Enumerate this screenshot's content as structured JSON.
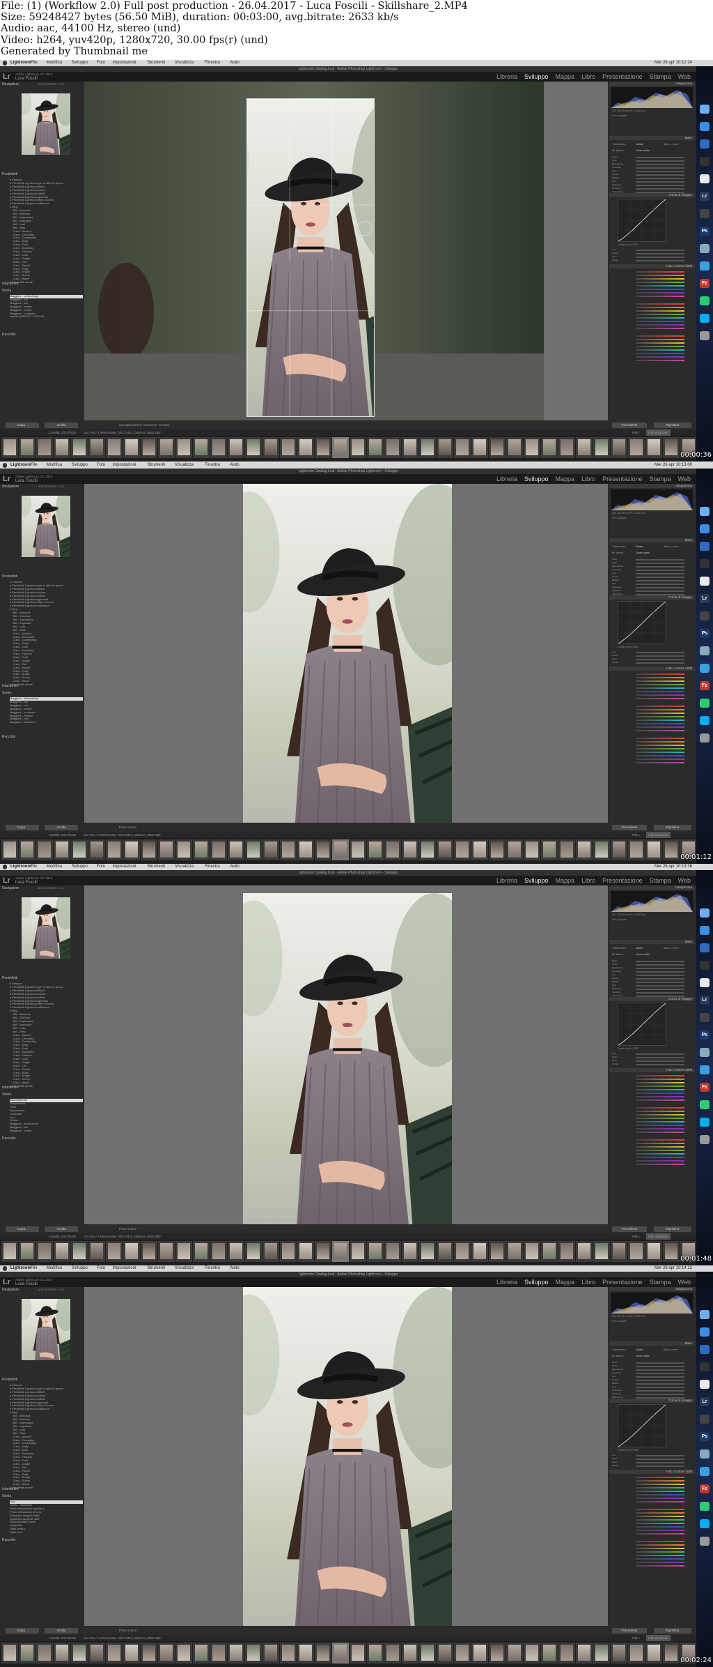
{
  "header": {
    "line1": "File: (1) (Workflow 2.0) Full post production - 26.04.2017 - Luca Foscili - Skillshare_2.MP4",
    "line2": "Size: 59248427 bytes (56.50 MiB), duration: 00:03:00, avg.bitrate: 2633 kb/s",
    "line3": "Audio: aac, 44100 Hz, stereo (und)",
    "line4": "Video: h264, yuv420p, 1280x720, 30.00 fps(r) (und)",
    "line5": "Generated by Thumbnail me"
  },
  "menubar": {
    "apple": "",
    "app": "Lightroom",
    "items": [
      "File",
      "Modifica",
      "Sviluppo",
      "Foto",
      "Impostazioni",
      "Strumenti",
      "Visualizza",
      "Finestra",
      "Aiuto"
    ]
  },
  "window_title": "Lightroom Catalog.lrcat - Adobe Photoshop Lightroom - Sviluppo",
  "identity": {
    "lr_logo": "Lr",
    "catalog_line": "Adobe Lightroom CC 2015",
    "user": "Luca Foscili"
  },
  "modules": [
    "Libreria",
    "Sviluppo",
    "Mappa",
    "Libro",
    "Presentazione",
    "Stampa",
    "Web"
  ],
  "left_panel": {
    "navigator_title": "Navigatore",
    "navigator_modes": "ADATTA  RIEMPI  1:1  3:1",
    "presets_title": "Predefiniti",
    "presets": [
      "Famous",
      "Predefiniti Lightroom per lo stile di ripresa",
      "Predefiniti Lightroom B&W",
      "Predefiniti Lightroom colore",
      "Predefiniti Lightroom effetti",
      "Predefiniti Lightroom generali",
      "Predefiniti Lightroom filtro di curve",
      "Predefiniti Lightroom nitidezza",
      "Reyt",
      "BW - Absolute",
      "BW - Extreme",
      "BW - Impressive",
      "BW - Impulsive",
      "BW - Lust",
      "BW - Raw",
      "Color - Ancient",
      "Color - Cinematic",
      "Color - Contrasting",
      "Color - Daily",
      "Color - Dark",
      "Color - Epiphany",
      "Color - Fashion",
      "Color - Cold",
      "Color - Jungle",
      "Color - Old",
      "Color - Pastel",
      "Color - Puffy",
      "Color - Shape",
      "Color - Sunny",
      "Color - Warm",
      "Predefiniti utente"
    ],
    "snapshots_title": "Istantanee",
    "history_title": "Storia",
    "history_frames": [
      [
        "Maggiore - ombre/corpi",
        "Maggiore - luci",
        "Maggiore - luci",
        "Maggiore - ombre",
        "Maggiore - ombre",
        "Maggiore - contrasto",
        "Importa (28/04/17 10:00:43)"
      ],
      [
        "Maggiore - saturazione",
        "Maggiore - luci",
        "Maggiore - luci",
        "Maggiore - ombre",
        "Maggiore - contrasto",
        "Maggiore - bianchi",
        "Maggiore - neri",
        "Maggiore - chiarezza"
      ],
      [
        "Bilanciamento",
        "Temperatura",
        "Tinta",
        "Esposizione",
        "Contrasto",
        "Luci",
        "Ombre",
        "Maggiore - saturazione",
        "Maggiore - luci",
        "Maggiore - ombre"
      ],
      [
        "Luci",
        "Livello - Stabilizza",
        "Punto selezionato rispetto a",
        "Punto selezionato di nero",
        "Selezione tangibile tratti",
        "Selezione tangibile tratti",
        "Ritorna profilo colore",
        "Anteprima",
        "Stato ombre",
        "Stato Luci"
      ]
    ],
    "collections_title": "Raccolte",
    "copy_button": "Copia...",
    "paste_button": "Incolla"
  },
  "toolbar": {
    "frame1": "Sovrapposizione strumento:  Sempre",
    "frame_other": "Prova colore"
  },
  "right_panel": {
    "histogram_title": "Istogramma",
    "histogram_readout": "ISO 200   50 mm   f/2,8   1/640 sec",
    "original_label": "Foto originale",
    "basic_title": "Base",
    "tonecurve_title": "Curva di viraggio",
    "hsl_title": "HSL / Colore / B/N",
    "treatment_label": "Trattamento:",
    "treatment_color": "Colore",
    "treatment_bw": "Bianco e nero",
    "wb_label": "Bil. bianco:",
    "wb_value": "Come scatto",
    "sliders_basic": [
      "Temp",
      "Tinta",
      "Esposizione",
      "Contrasto",
      "Luci",
      "Ombre",
      "Bianchi",
      "Neri",
      "Chiarezza",
      "Vividezza",
      "Saturazione"
    ],
    "sliders_curve": [
      "Luci",
      "Chiari",
      "Scuri",
      "Ombre"
    ],
    "curve_channel": "Canale punti: RGB",
    "previous_button": "Precedente",
    "reset_button": "Ripristina"
  },
  "filmstrip": {
    "folder_info": "Cartella: 2017/0410",
    "count_info": "144 foto / 1 selezionate / 20170410_Dabrina_0182.NEF",
    "filter_label": "Filtro:",
    "filter_value": "Filtri disattivati"
  },
  "frames": [
    {
      "time": "00:00:36",
      "clock": "Mer 26 apr  10:12:24"
    },
    {
      "time": "00:01:12",
      "clock": "Mer 26 apr  10:13:00"
    },
    {
      "time": "00:01:48",
      "clock": "Mer 26 apr  10:13:36"
    },
    {
      "time": "00:02:24",
      "clock": "Mer 26 apr  10:14:12"
    }
  ],
  "dock_icons": [
    "finder-icon",
    "safari-icon",
    "compass-icon",
    "steam-icon",
    "photos-icon",
    "lightroom-icon",
    "camera-icon",
    "photoshop-icon",
    "preview-icon",
    "mail-icon",
    "filezilla-icon",
    "facetime-icon",
    "skype-icon",
    "trash-icon"
  ],
  "dock_labels": {
    "lr": "Lr",
    "ps": "Ps",
    "fz": "Fz"
  }
}
